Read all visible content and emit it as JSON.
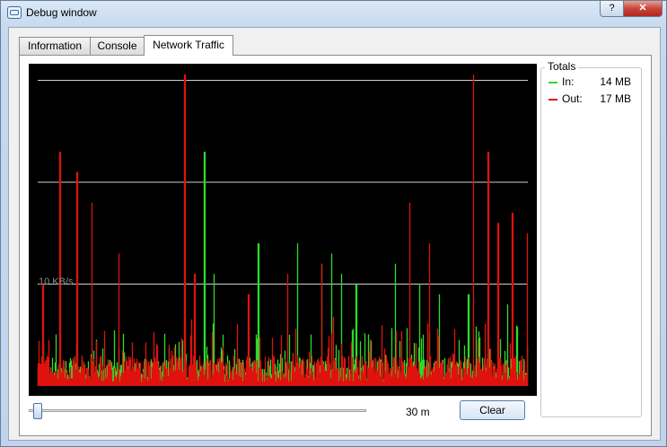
{
  "window": {
    "title": "Debug window",
    "help_glyph": "?",
    "close_glyph": "✕"
  },
  "tabs": [
    {
      "label": "Information"
    },
    {
      "label": "Console"
    },
    {
      "label": "Network Traffic"
    }
  ],
  "graph": {
    "grid_label": "10 KB/s"
  },
  "slider": {
    "value_label": "30 m"
  },
  "buttons": {
    "clear": "Clear"
  },
  "totals": {
    "title": "Totals",
    "in": {
      "label": "In:",
      "value": "14 MB",
      "color": "#2bdc2b"
    },
    "out": {
      "label": "Out:",
      "value": "17 MB",
      "color": "#e0120e"
    }
  },
  "chart_data": {
    "type": "area",
    "series": [
      {
        "name": "In",
        "color": "#2bdc2b",
        "peaks": [
          {
            "i": 0.34,
            "v": 23
          },
          {
            "i": 0.36,
            "v": 11
          },
          {
            "i": 0.45,
            "v": 14
          },
          {
            "i": 0.53,
            "v": 14
          },
          {
            "i": 0.58,
            "v": 12
          },
          {
            "i": 0.6,
            "v": 13
          },
          {
            "i": 0.62,
            "v": 11
          },
          {
            "i": 0.65,
            "v": 10
          },
          {
            "i": 0.73,
            "v": 12
          },
          {
            "i": 0.78,
            "v": 10
          },
          {
            "i": 0.82,
            "v": 9
          },
          {
            "i": 0.88,
            "v": 9
          },
          {
            "i": 0.96,
            "v": 8
          }
        ]
      },
      {
        "name": "Out",
        "color": "#e0120e",
        "peaks": [
          {
            "i": 0.01,
            "v": 10
          },
          {
            "i": 0.045,
            "v": 23
          },
          {
            "i": 0.08,
            "v": 21
          },
          {
            "i": 0.11,
            "v": 18
          },
          {
            "i": 0.165,
            "v": 13
          },
          {
            "i": 0.3,
            "v": 31
          },
          {
            "i": 0.32,
            "v": 11
          },
          {
            "i": 0.43,
            "v": 9
          },
          {
            "i": 0.51,
            "v": 11
          },
          {
            "i": 0.58,
            "v": 12
          },
          {
            "i": 0.76,
            "v": 18
          },
          {
            "i": 0.8,
            "v": 14
          },
          {
            "i": 0.89,
            "v": 31
          },
          {
            "i": 0.92,
            "v": 23
          },
          {
            "i": 0.94,
            "v": 16
          },
          {
            "i": 0.97,
            "v": 17
          },
          {
            "i": 1.0,
            "v": 15
          }
        ]
      }
    ],
    "ylabel": "10 KB/s",
    "gridlines_kbps": [
      10,
      20,
      30
    ],
    "ylim": [
      0,
      32
    ],
    "grid": true
  }
}
